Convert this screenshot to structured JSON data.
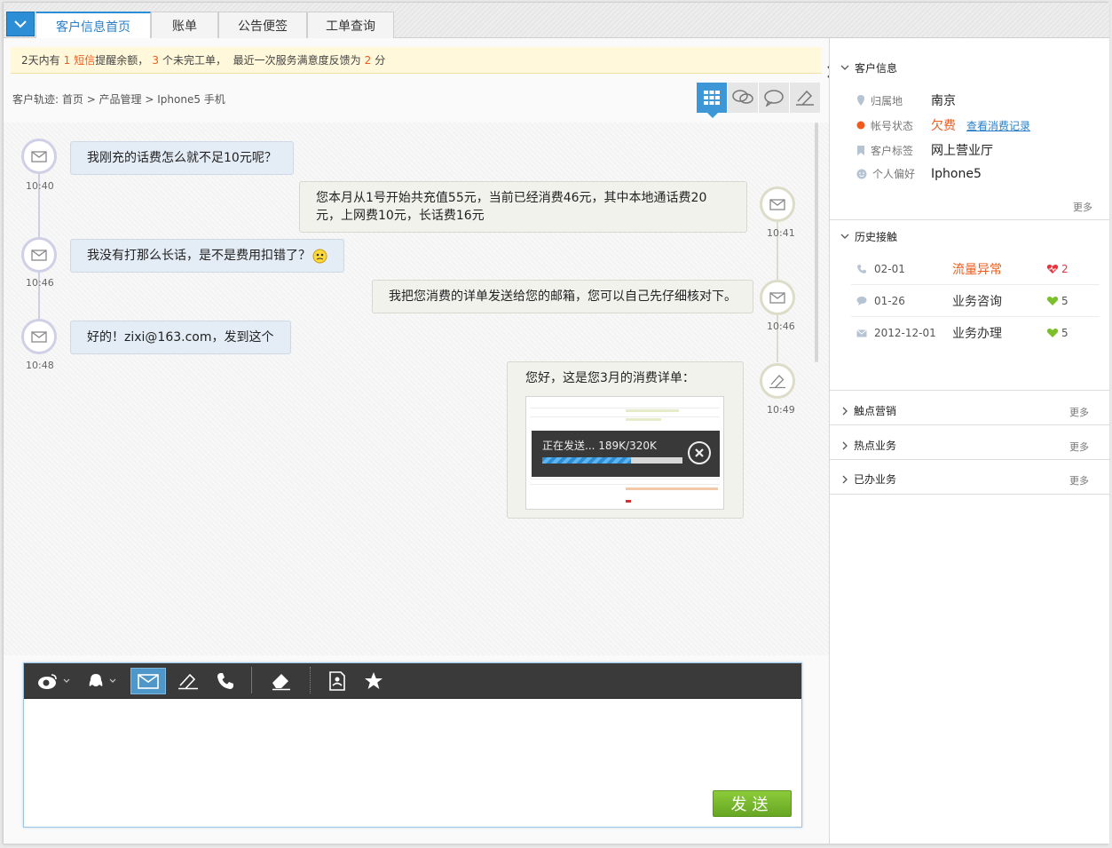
{
  "tabs": [
    {
      "label": "客户信息首页",
      "active": true
    },
    {
      "label": "账单",
      "active": false
    },
    {
      "label": "公告便签",
      "active": false
    },
    {
      "label": "工单查询",
      "active": false
    }
  ],
  "alert": {
    "p1": "2天内有",
    "n1": "1",
    "link": "短信",
    "p2": "提醒余额，",
    "n2": "3",
    "p3": "个未完工单，  最近一次服务满意度反馈为",
    "n3": "2",
    "p4": "分"
  },
  "trail": {
    "label": "客户轨迹:",
    "path": "首页 > 产品管理 > Iphone5 手机"
  },
  "messages": [
    {
      "side": "in",
      "icon": "mail-icon",
      "time": "10:40",
      "text": "我刚充的话费怎么就不足10元呢？"
    },
    {
      "side": "out",
      "icon": "mail-icon",
      "time": "10:41",
      "text": "您本月从1号开始共充值55元，当前已经消费46元，其中本地通话费20元，上网费10元，长话费16元"
    },
    {
      "side": "in",
      "icon": "mail-icon",
      "time": "10:46",
      "text": "我没有打那么长话，是不是费用扣错了？"
    },
    {
      "side": "out",
      "icon": "mail-icon",
      "time": "10:46",
      "text": "我把您消费的详单发送给您的邮箱，您可以自己先仔细核对下。"
    },
    {
      "side": "in",
      "icon": "mail-icon",
      "time": "10:48",
      "text": "好的！zixi@163.com，发到这个"
    },
    {
      "side": "out",
      "icon": "note-icon",
      "time": "10:49",
      "text": "您好，这是您3月的消费详单："
    }
  ],
  "upload": {
    "status": "正在发送...",
    "size": "189K/320K",
    "progress": 0.63
  },
  "composer": {
    "send_label": "发送"
  },
  "customer_info": {
    "title": "客户信息",
    "fields": [
      {
        "key": "归属地",
        "value": "南京"
      },
      {
        "key": "帐号状态",
        "value": "欠费",
        "link": "查看消费记录"
      },
      {
        "key": "客户标签",
        "value": "网上营业厅"
      },
      {
        "key": "个人偏好",
        "value": "Iphone5"
      }
    ],
    "more": "更多"
  },
  "history": {
    "title": "历史接触",
    "rows": [
      {
        "icon": "phone-icon",
        "date": "02-01",
        "type": "流量异常",
        "score": "2",
        "alert": true
      },
      {
        "icon": "chat-icon",
        "date": "01-26",
        "type": "业务咨询",
        "score": "5",
        "alert": false
      },
      {
        "icon": "mail-icon",
        "date": "2012-12-01",
        "type": "业务办理",
        "score": "5",
        "alert": false
      }
    ]
  },
  "sections": [
    {
      "title": "触点营销",
      "more": "更多"
    },
    {
      "title": "热点业务",
      "more": "更多"
    },
    {
      "title": "已办业务",
      "more": "更多"
    }
  ],
  "colors": {
    "accent": "#2c8fd6",
    "warn": "#f05a1c",
    "heart_red": "#e8323c",
    "heart_green": "#7bbf2a",
    "send_green": "#78b92d"
  }
}
